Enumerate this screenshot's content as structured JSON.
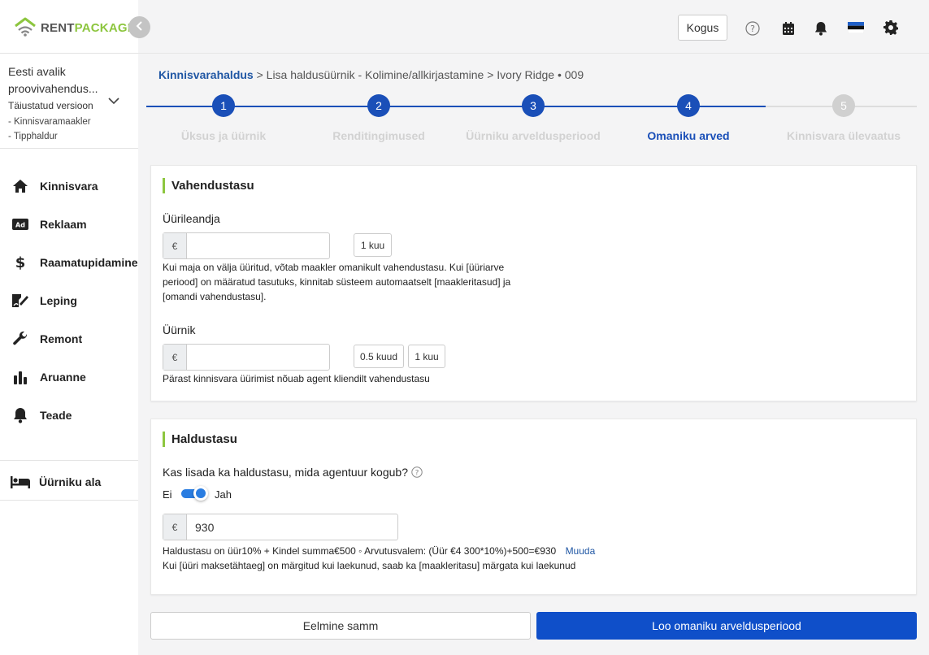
{
  "brand": {
    "rent": "RENT",
    "package": "PACKAGE"
  },
  "org": {
    "name_line1": "Eesti avalik",
    "name_line2": "proovivahendus...",
    "version": "Täiustatud versioon",
    "roles": [
      "- Kinnisvaramaakler",
      "- Tipphaldur"
    ]
  },
  "nav": [
    {
      "label": "Kinnisvara",
      "icon": "home-icon"
    },
    {
      "label": "Reklaam",
      "icon": "ad-icon"
    },
    {
      "label": "Raamatupidamine",
      "icon": "dollar-icon"
    },
    {
      "label": "Leping",
      "icon": "contract-icon"
    },
    {
      "label": "Remont",
      "icon": "wrench-icon"
    },
    {
      "label": "Aruanne",
      "icon": "bar-chart-icon"
    },
    {
      "label": "Teade",
      "icon": "bell-icon"
    }
  ],
  "tenant_area": {
    "label": "Üürniku ala",
    "icon": "bed-icon"
  },
  "topbar": {
    "kogus": "Kogus",
    "icons": [
      "help-icon",
      "calendar-icon",
      "bell-icon",
      "estonian-flag-icon",
      "settings-gear-icon"
    ]
  },
  "breadcrumb": {
    "root": "Kinnisvarahaldus",
    "rest": " > Lisa haldusüürnik - Kolimine/allkirjastamine > Ivory Ridge • 009"
  },
  "steps": [
    {
      "num": "1",
      "label": "Üksus ja üürnik",
      "state": "done"
    },
    {
      "num": "2",
      "label": "Renditingimused",
      "state": "done"
    },
    {
      "num": "3",
      "label": "Üürniku arveldusperiood",
      "state": "done"
    },
    {
      "num": "4",
      "label": "Omaniku arved",
      "state": "active"
    },
    {
      "num": "5",
      "label": "Kinnisvara ülevaatus",
      "state": "pending"
    }
  ],
  "commission": {
    "title": "Vahendustasu",
    "landlord": {
      "label": "Üürileandja",
      "currency": "€",
      "value": "",
      "chips": [
        "1 kuu"
      ],
      "help": [
        "Kui maja on välja üüritud, võtab maakler omanikult vahendustasu. Kui [üüriarve",
        "periood] on määratud tasutuks, kinnitab süsteem automaatselt [maakleritasud] ja",
        "[omandi vahendustasu]."
      ]
    },
    "tenant": {
      "label": "Üürnik",
      "currency": "€",
      "value": "",
      "chips": [
        "0.5 kuud",
        "1 kuu"
      ],
      "help": "Pärast kinnisvara üürimist nõuab agent kliendilt vahendustasu"
    }
  },
  "management": {
    "title": "Haldustasu",
    "question": "Kas lisada ka haldustasu, mida agentuur kogub?",
    "toggle_off": "Ei",
    "toggle_on": "Jah",
    "toggle_state": "on",
    "currency": "€",
    "value": "930",
    "formula": "Haldustasu on üür10% + Kindel summa€500 ◦ Arvutusvalem: (Üür €4 300*10%)+500=€930",
    "edit_link": "Muuda",
    "note": "Kui [üüri maksetähtaeg] on märgitud kui laekunud, saab ka [maakleritasu] märgata kui laekunud"
  },
  "actions": {
    "prev": "Eelmine samm",
    "next": "Loo omaniku arveldusperiood"
  },
  "colors": {
    "primary": "#0f4fc9",
    "step_done": "#1a4fb8",
    "step_pending": "#d0d0d0",
    "accent_green": "#8dc63f",
    "link": "#2057a4",
    "toggle_blue": "#2a7de1"
  }
}
